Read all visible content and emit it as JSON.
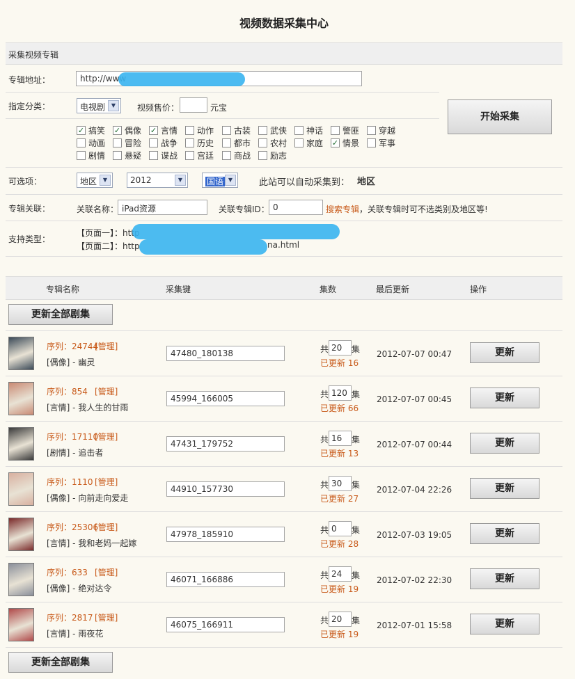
{
  "page_title": "视频数据采集中心",
  "section_title": "采集视频专辑",
  "url_label": "专辑地址：",
  "url_value": "http://www",
  "category_label": "指定分类：",
  "category_value": "电视剧",
  "price_label": "视频售价：",
  "price_unit": "元宝",
  "start_button": "开始采集",
  "genres": [
    {
      "label": "搞笑",
      "checked": true
    },
    {
      "label": "偶像",
      "checked": true
    },
    {
      "label": "言情",
      "checked": true
    },
    {
      "label": "动作",
      "checked": false
    },
    {
      "label": "古装",
      "checked": false
    },
    {
      "label": "武侠",
      "checked": false
    },
    {
      "label": "神话",
      "checked": false
    },
    {
      "label": "警匪",
      "checked": false
    },
    {
      "label": "穿越",
      "checked": false
    },
    {
      "label": "动画",
      "checked": false
    },
    {
      "label": "冒险",
      "checked": false
    },
    {
      "label": "战争",
      "checked": false
    },
    {
      "label": "历史",
      "checked": false
    },
    {
      "label": "都市",
      "checked": false
    },
    {
      "label": "农村",
      "checked": false
    },
    {
      "label": "家庭",
      "checked": false
    },
    {
      "label": "情景",
      "checked": true
    },
    {
      "label": "军事",
      "checked": false
    },
    {
      "label": "剧情",
      "checked": false
    },
    {
      "label": "悬疑",
      "checked": false
    },
    {
      "label": "谍战",
      "checked": false
    },
    {
      "label": "宫廷",
      "checked": false
    },
    {
      "label": "商战",
      "checked": false
    },
    {
      "label": "励志",
      "checked": false
    }
  ],
  "options_label": "可选项：",
  "region_value": "地区",
  "year_value": "2012",
  "lang_value": "国语",
  "auto_note": "此站可以自动采集到：",
  "auto_value": "地区",
  "assoc_label": "专辑关联：",
  "assoc_name_label": "关联名称：",
  "assoc_name_value": "iPad资源",
  "assoc_id_label": "关联专辑ID：",
  "assoc_id_value": "0",
  "search_link": "搜索专辑",
  "search_note": "，关联专辑时可不选类别及地区等!",
  "support_label": "支持类型：",
  "support_line1": "【页面一】：http",
  "support_line2": "【页面二】：http",
  "support_line2_tail": "na.html",
  "table_headers": [
    "专辑名称",
    "采集键",
    "集数",
    "最后更新",
    "操作"
  ],
  "update_all": "更新全部剧集",
  "update_btn": "更新",
  "serial_prefix": "序列：",
  "manage_text": "[管理]",
  "total_prefix": "共",
  "total_suffix": "集",
  "updated_prefix": "已更新 ",
  "rows": [
    {
      "serial": "24744",
      "name": "[偶像] - 幽灵",
      "key": "47480_180138",
      "total": "20",
      "updated": "16",
      "date": "2012-07-07 00:47",
      "color": "#3b4a58"
    },
    {
      "serial": "854",
      "name": "[言情] - 我人生的甘雨",
      "key": "45994_166005",
      "total": "120",
      "updated": "66",
      "date": "2012-07-07 00:45",
      "color": "#c98a74"
    },
    {
      "serial": "17110",
      "name": "[剧情] - 追击者",
      "key": "47431_179752",
      "total": "16",
      "updated": "13",
      "date": "2012-07-07 00:44",
      "color": "#3a3a3a"
    },
    {
      "serial": "1110",
      "name": "[偶像] - 向前走向爱走",
      "key": "44910_157730",
      "total": "30",
      "updated": "27",
      "date": "2012-07-04 22:26",
      "color": "#d8b0a0"
    },
    {
      "serial": "25306",
      "name": "[言情] - 我和老妈一起嫁",
      "key": "47978_185910",
      "total": "0",
      "updated": "28",
      "date": "2012-07-03 19:05",
      "color": "#7a2a2a"
    },
    {
      "serial": "633",
      "name": "[偶像] - 绝对达令",
      "key": "46071_166886",
      "total": "24",
      "updated": "19",
      "date": "2012-07-02 22:30",
      "color": "#8a8f9a"
    },
    {
      "serial": "2817",
      "name": "[言情] - 雨夜花",
      "key": "46075_166911",
      "total": "20",
      "updated": "19",
      "date": "2012-07-01 15:58",
      "color": "#b04a4a"
    }
  ]
}
